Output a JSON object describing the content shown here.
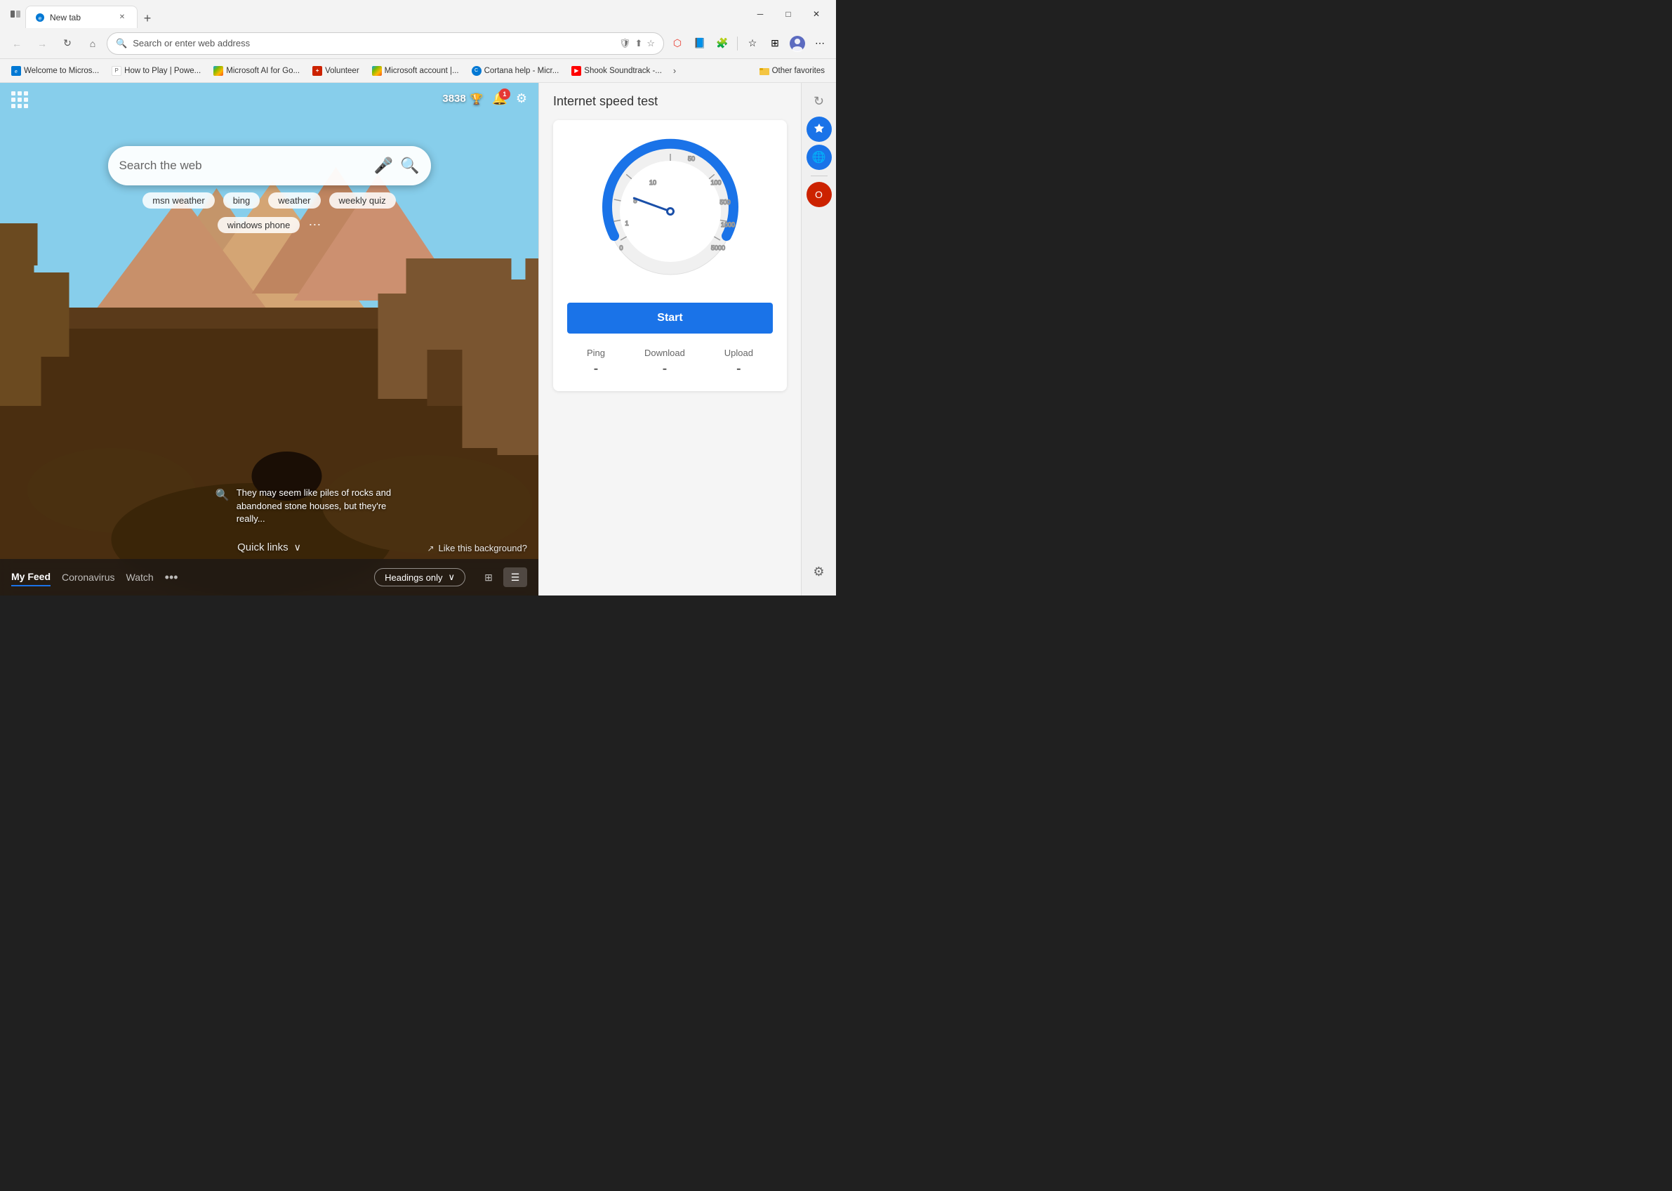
{
  "titlebar": {
    "tab_label": "New tab",
    "new_tab_icon": "+",
    "minimize": "─",
    "maximize": "□",
    "close": "✕",
    "sidebar_icon": "☰"
  },
  "navbar": {
    "back_icon": "←",
    "forward_icon": "→",
    "refresh_icon": "↻",
    "home_icon": "⌂",
    "search_placeholder": "Search or enter web address",
    "address_text": "Search or enter web address"
  },
  "bookmarks": [
    {
      "label": "Welcome to Micros...",
      "color": "edge"
    },
    {
      "label": "How to Play | Powe...",
      "color": "ms"
    },
    {
      "label": "Microsoft AI for Go...",
      "color": "grid"
    },
    {
      "label": "Volunteer",
      "color": "red"
    },
    {
      "label": "Microsoft account |...",
      "color": "grid"
    },
    {
      "label": "Cortana help - Micr...",
      "color": "cortana"
    },
    {
      "label": "Shook Soundtrack -...",
      "color": "yt"
    }
  ],
  "bookmarks_more": "›",
  "bookmarks_folder_label": "Other favorites",
  "newtab": {
    "points": "3838",
    "notification_count": "1",
    "search_placeholder": "Search the web",
    "suggestions": [
      "msn weather",
      "bing",
      "weather",
      "weekly quiz",
      "windows phone"
    ],
    "photo_info_text": "They may seem like piles of rocks and abandoned stone houses, but they're really...",
    "quick_links_label": "Quick links",
    "like_bg_text": "Like this background?"
  },
  "bottom_bar": {
    "my_feed": "My Feed",
    "coronavirus": "Coronavirus",
    "watch": "Watch",
    "dots": "•••",
    "headings_only": "Headings only",
    "chevron_down": "∨"
  },
  "speed_test": {
    "title": "Internet speed test",
    "start_label": "Start",
    "ping_label": "Ping",
    "download_label": "Download",
    "upload_label": "Upload",
    "ping_value": "-",
    "download_value": "-",
    "upload_value": "-",
    "gauge_labels": [
      "0",
      "1",
      "5",
      "10",
      "50",
      "100",
      "500",
      "1000",
      "5000"
    ]
  }
}
